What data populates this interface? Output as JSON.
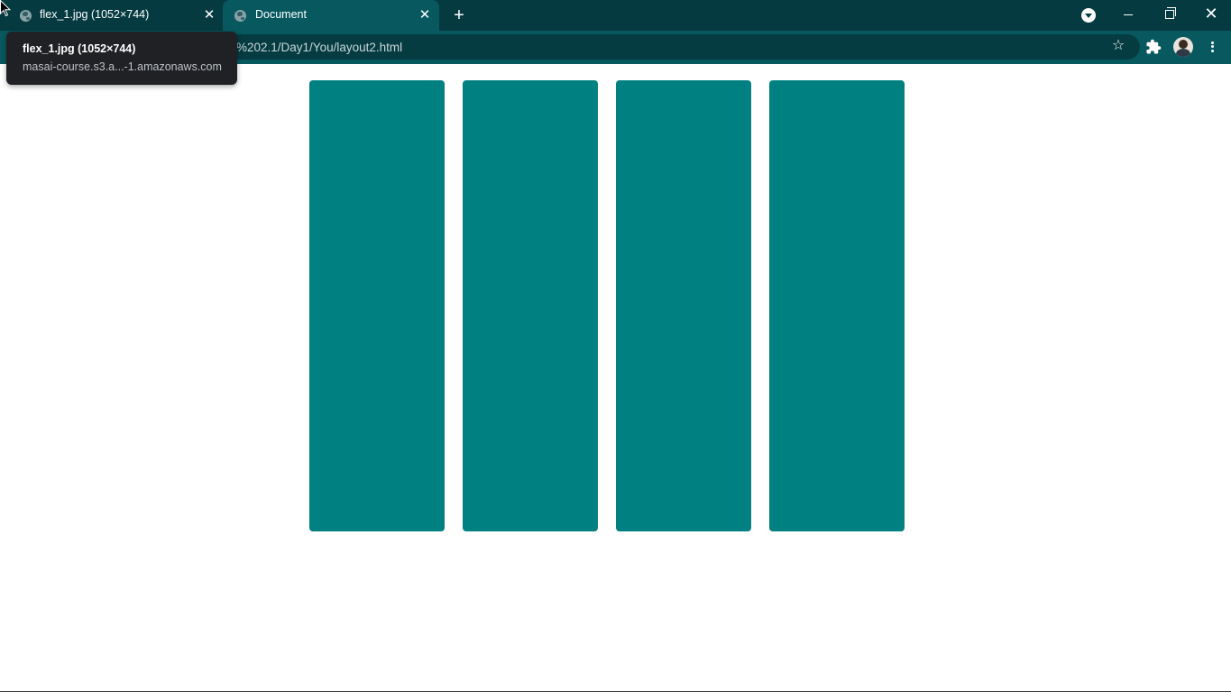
{
  "tabs": [
    {
      "title": "flex_1.jpg (1052×744)",
      "active": false
    },
    {
      "title": "Document",
      "active": true
    }
  ],
  "toolbar": {
    "address": "%202.1/Day1/You/layout2.html"
  },
  "tooltip": {
    "title": "flex_1.jpg (1052×744)",
    "url": "masai-course.s3.a...-1.amazonaws.com"
  },
  "page": {
    "boxes": [
      {
        "color": "#008080"
      },
      {
        "color": "#008080"
      },
      {
        "color": "#008080"
      },
      {
        "color": "#008080"
      }
    ]
  },
  "colors": {
    "tabstrip": "#043a40",
    "toolbar": "#07595f",
    "box": "#008080"
  },
  "icons": {
    "favicon": "globe-icon",
    "close": "close-icon",
    "new_tab": "plus-icon",
    "tab_search": "chevron-down-circle-icon",
    "bookmark": "star-icon",
    "extensions": "puzzle-icon",
    "menu": "kebab-menu-icon"
  }
}
